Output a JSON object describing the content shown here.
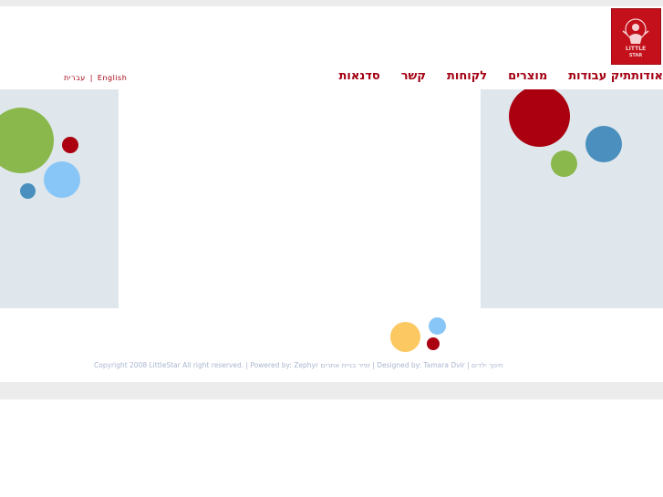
{
  "logo": {
    "text_line1": "LITTLE",
    "text_line2": "STAR"
  },
  "nav": {
    "items": [
      {
        "label": "אודות"
      },
      {
        "label": "תיק עבודות"
      },
      {
        "label": "מוצרים"
      },
      {
        "label": "לקוחות"
      },
      {
        "label": "קשר"
      },
      {
        "label": "סדנאות"
      }
    ]
  },
  "language": {
    "hebrew": "עברית",
    "separator": "|",
    "english": "English"
  },
  "footer": {
    "copyright": "Copyright 2008 LittleStar All right reserved.",
    "sep1": "|",
    "powered_by": "Powered by: Zephyr זפיר בניית אתרים",
    "sep2": "|",
    "designed_by": "Designed by: Tamara Dvir",
    "sep3": "|",
    "tag": "חינוך ילדים"
  },
  "colors": {
    "brand_red": "#a30012",
    "green": "#8ab84d",
    "light_blue": "#88c6f7",
    "steel_blue": "#4a8fbd",
    "yellow": "#fcc862",
    "panel_bg": "#dfe7ec"
  }
}
